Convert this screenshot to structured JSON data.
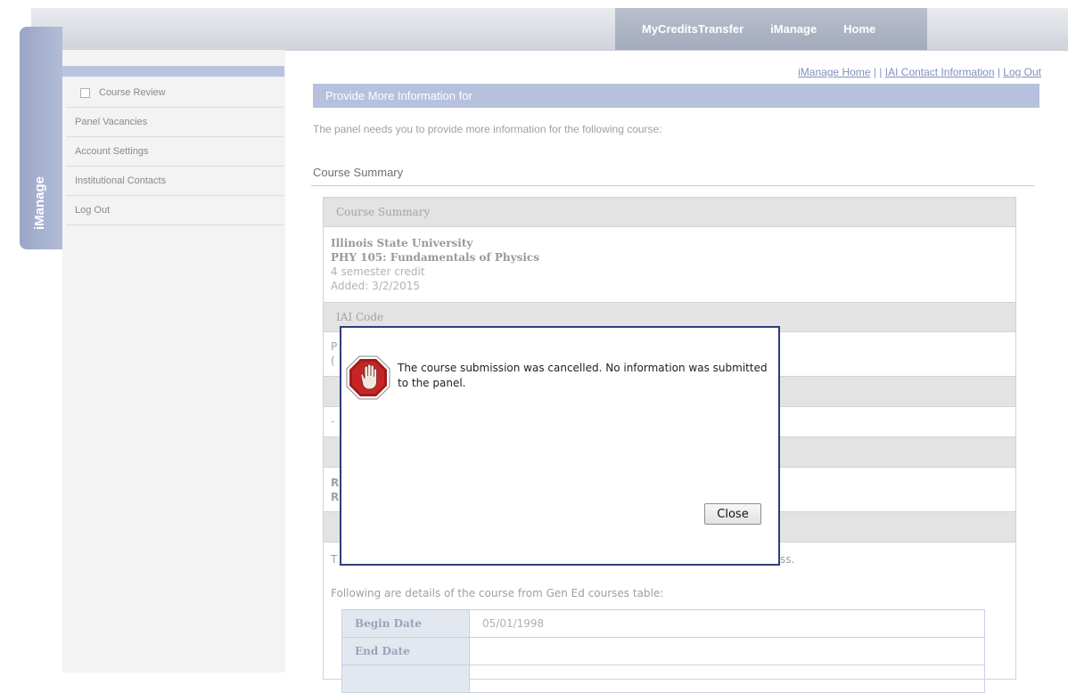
{
  "topnav": {
    "items": [
      "MyCreditsTransfer",
      "iManage",
      "Home"
    ]
  },
  "sidetab": {
    "label": "iManage"
  },
  "sidebar": {
    "items": [
      {
        "label": "Course Review"
      },
      {
        "label": "Panel Vacancies"
      },
      {
        "label": "Account Settings"
      },
      {
        "label": "Institutional Contacts"
      },
      {
        "label": "Log Out"
      }
    ]
  },
  "toplinks": {
    "home": "iManage Home",
    "sep1": " | | ",
    "contact": "IAI Contact Information",
    "sep2": " | ",
    "logout": "Log Out"
  },
  "main": {
    "header": "Provide More Information for",
    "panel_text": "The panel needs you to provide more information for the following course:",
    "summary_heading": "Course Summary",
    "summary_box": {
      "section_title": "Course Summary",
      "institution": "Illinois State University",
      "course": "PHY 105: Fundamentals of Physics",
      "credit": "4 semester credit",
      "added": "Added: 3/2/2015",
      "iai_code_title": "IAI Code",
      "iai_code_fragment": "P",
      "iai_code_fragment2": "(",
      "dash_row": "-",
      "r_line1": "R",
      "r_line2": "R",
      "t_fragment": "T",
      "ss_fragment": "ss.",
      "gen_ed_text": "Following are details of the course from Gen Ed courses table:",
      "details": [
        {
          "label": "Begin Date",
          "value": "05/01/1998"
        },
        {
          "label": "End Date",
          "value": ""
        }
      ]
    }
  },
  "modal": {
    "message": "The course submission was cancelled. No information was submitted to the panel.",
    "close_label": "Close"
  }
}
